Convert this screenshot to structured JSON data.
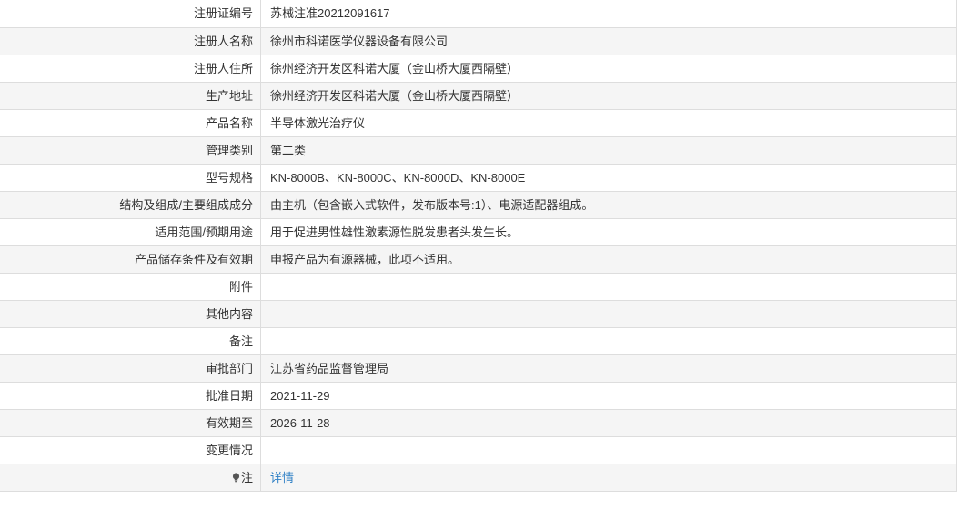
{
  "rows": [
    {
      "label": "注册证编号",
      "value": "苏械注准20212091617"
    },
    {
      "label": "注册人名称",
      "value": "徐州市科诺医学仪器设备有限公司"
    },
    {
      "label": "注册人住所",
      "value": "徐州经济开发区科诺大厦（金山桥大厦西隔壁）"
    },
    {
      "label": "生产地址",
      "value": "徐州经济开发区科诺大厦（金山桥大厦西隔壁）"
    },
    {
      "label": "产品名称",
      "value": "半导体激光治疗仪"
    },
    {
      "label": "管理类别",
      "value": "第二类"
    },
    {
      "label": "型号规格",
      "value": "KN-8000B、KN-8000C、KN-8000D、KN-8000E"
    },
    {
      "label": "结构及组成/主要组成成分",
      "value": "由主机（包含嵌入式软件，发布版本号:1）、电源适配器组成。"
    },
    {
      "label": "适用范围/预期用途",
      "value": "用于促进男性雄性激素源性脱发患者头发生长。"
    },
    {
      "label": "产品储存条件及有效期",
      "value": "申报产品为有源器械，此项不适用。"
    },
    {
      "label": "附件",
      "value": ""
    },
    {
      "label": "其他内容",
      "value": ""
    },
    {
      "label": "备注",
      "value": ""
    },
    {
      "label": "审批部门",
      "value": "江苏省药品监督管理局"
    },
    {
      "label": "批准日期",
      "value": "2021-11-29"
    },
    {
      "label": "有效期至",
      "value": "2026-11-28"
    },
    {
      "label": "变更情况",
      "value": ""
    }
  ],
  "note_row": {
    "icon": "lightbulb-icon",
    "label": "注",
    "link_text": "详情"
  },
  "colors": {
    "border": "#dddddd",
    "alt_row": "#f5f5f5",
    "text": "#333333",
    "link": "#2d7fc5"
  }
}
